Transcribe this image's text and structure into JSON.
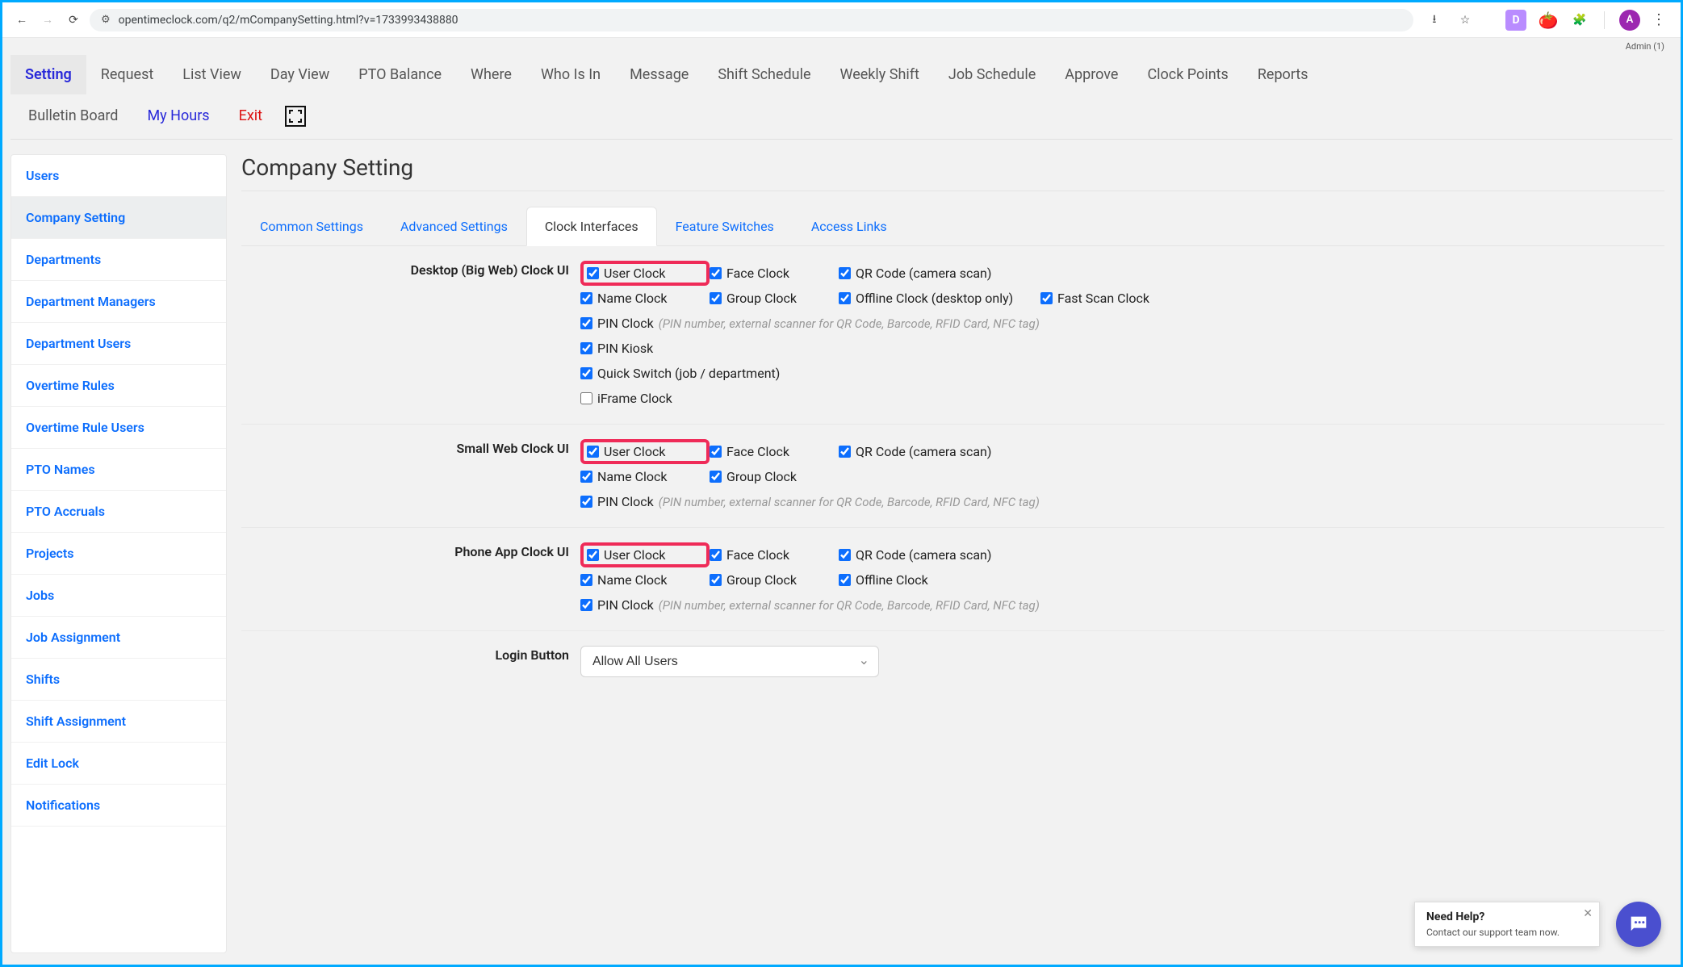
{
  "browser": {
    "url": "opentimeclock.com/q2/mCompanySetting.html?v=1733993438880",
    "avatar_initial": "A",
    "ext_d": "D"
  },
  "header": {
    "admin_label": "Admin (1)",
    "nav": [
      "Setting",
      "Request",
      "List View",
      "Day View",
      "PTO Balance",
      "Where",
      "Who Is In",
      "Message",
      "Shift Schedule",
      "Weekly Shift",
      "Job Schedule",
      "Approve",
      "Clock Points",
      "Reports"
    ],
    "nav_active_index": 0,
    "nav2": {
      "bulletin": "Bulletin Board",
      "myhours": "My Hours",
      "exit": "Exit"
    }
  },
  "sidebar": {
    "items": [
      "Users",
      "Company Setting",
      "Departments",
      "Department Managers",
      "Department Users",
      "Overtime Rules",
      "Overtime Rule Users",
      "PTO Names",
      "PTO Accruals",
      "Projects",
      "Jobs",
      "Job Assignment",
      "Shifts",
      "Shift Assignment",
      "Edit Lock",
      "Notifications"
    ],
    "active_index": 1
  },
  "page": {
    "title": "Company Setting",
    "tabs": [
      "Common Settings",
      "Advanced Settings",
      "Clock Interfaces",
      "Feature Switches",
      "Access Links"
    ],
    "active_tab_index": 2
  },
  "sections": {
    "desktop": {
      "label": "Desktop (Big Web) Clock UI",
      "items": {
        "user_clock": "User Clock",
        "face_clock": "Face Clock",
        "qr_code": "QR Code (camera scan)",
        "name_clock": "Name Clock",
        "group_clock": "Group Clock",
        "offline_clock": "Offline Clock (desktop only)",
        "fast_scan": "Fast Scan Clock",
        "pin_clock": "PIN Clock",
        "pin_desc": "(PIN number, external scanner for QR Code, Barcode, RFID Card, NFC tag)",
        "pin_kiosk": "PIN Kiosk",
        "quick_switch": "Quick Switch (job / department)",
        "iframe_clock": "iFrame Clock"
      }
    },
    "smallweb": {
      "label": "Small Web Clock UI",
      "items": {
        "user_clock": "User Clock",
        "face_clock": "Face Clock",
        "qr_code": "QR Code (camera scan)",
        "name_clock": "Name Clock",
        "group_clock": "Group Clock",
        "pin_clock": "PIN Clock",
        "pin_desc": "(PIN number, external scanner for QR Code, Barcode, RFID Card, NFC tag)"
      }
    },
    "phone": {
      "label": "Phone App Clock UI",
      "items": {
        "user_clock": "User Clock",
        "face_clock": "Face Clock",
        "qr_code": "QR Code (camera scan)",
        "name_clock": "Name Clock",
        "group_clock": "Group Clock",
        "offline_clock": "Offline Clock",
        "pin_clock": "PIN Clock",
        "pin_desc": "(PIN number, external scanner for QR Code, Barcode, RFID Card, NFC tag)"
      }
    },
    "login_button": {
      "label": "Login Button",
      "selected": "Allow All Users"
    }
  },
  "help": {
    "title": "Need Help?",
    "sub": "Contact our support team now."
  }
}
